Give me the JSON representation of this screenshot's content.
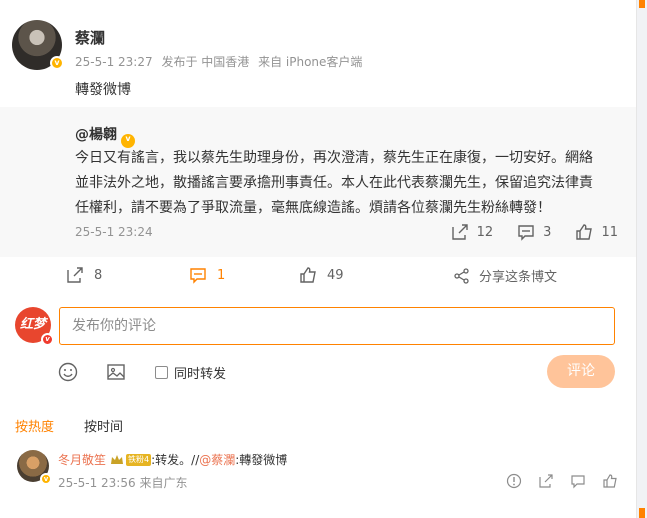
{
  "post": {
    "author": "蔡瀾",
    "time": "25-5-1 23:27",
    "location": "发布于 中国香港",
    "source": "来自 iPhone客户端",
    "text": "轉發微博"
  },
  "repost": {
    "author": "@楊翱",
    "text": "今日又有謠言，我以蔡先生助理身份，再次澄清，蔡先生正在康復，一切安好。網絡並非法外之地，散播謠言要承擔刑事責任。本人在此代表蔡瀾先生，保留追究法律責任權利，請不要為了爭取流量，毫無底線造謠。煩請各位蔡瀾先生粉絲轉發！",
    "time": "25-5-1 23:24",
    "shares": "12",
    "comments": "3",
    "likes": "11"
  },
  "actions": {
    "shares": "8",
    "comments": "1",
    "likes": "49",
    "share_label": "分享这条博文"
  },
  "comment_box": {
    "avatar_text": "红梦",
    "placeholder": "发布你的评论",
    "sync_label": "同时转发",
    "submit_label": "评论"
  },
  "sort": {
    "hot": "按热度",
    "time": "按时间"
  },
  "comment": {
    "name": "冬月敬笙",
    "fan_tag": "铁粉4",
    "text": ":转发。//",
    "mention": "@蔡瀾",
    "quote": ":轉發微博",
    "time": "25-5-1 23:56",
    "location": "来自广东"
  },
  "colors": {
    "accent": "#ff8200",
    "link": "#eb7350",
    "muted": "#939393"
  }
}
